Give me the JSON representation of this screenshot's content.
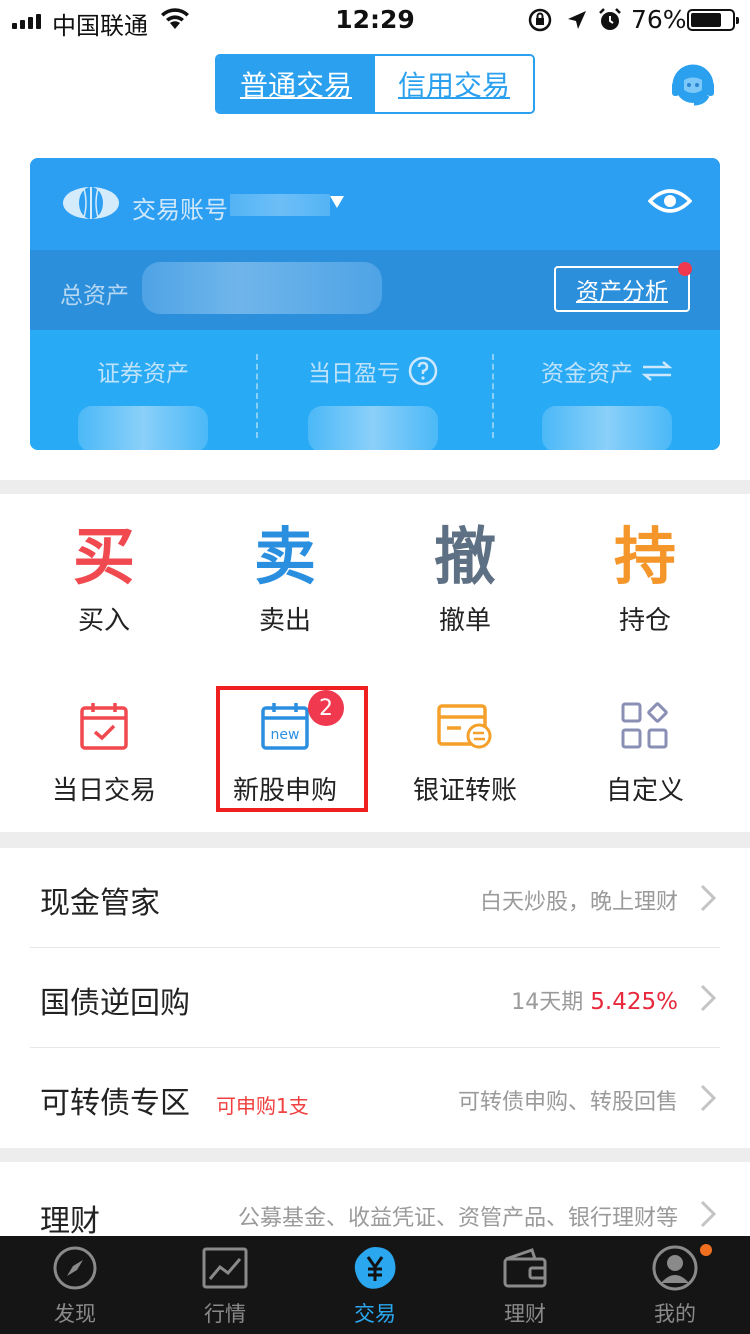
{
  "status_bar": {
    "carrier": "中国联通",
    "time": "12:29",
    "battery_percent": "76%",
    "battery_level": 0.76
  },
  "header": {
    "segment_active": "普通交易",
    "segment_inactive": "信用交易",
    "service_icon": "customer-service-icon"
  },
  "account_card": {
    "account_label": "交易账号",
    "total_assets_label": "总资产",
    "analysis_button": "资产分析",
    "stats": [
      {
        "label": "证券资产"
      },
      {
        "label": "当日盈亏"
      },
      {
        "label": "资金资产"
      }
    ]
  },
  "quick_actions": {
    "primary": [
      {
        "char": "买",
        "label": "买入",
        "color": "#f0494f"
      },
      {
        "char": "卖",
        "label": "卖出",
        "color": "#2b8fe0"
      },
      {
        "char": "撤",
        "label": "撤单",
        "color": "#5e7083"
      },
      {
        "char": "持",
        "label": "持仓",
        "color": "#f5962a"
      }
    ],
    "secondary": [
      {
        "label": "当日交易",
        "icon": "calendar-check-icon"
      },
      {
        "label": "新股申购",
        "icon": "calendar-new-icon",
        "badge": "2",
        "icon_text": "new"
      },
      {
        "label": "银证转账",
        "icon": "card-transfer-icon"
      },
      {
        "label": "自定义",
        "icon": "grid-icon"
      }
    ]
  },
  "menu_list": [
    {
      "title": "现金管家",
      "right_text": "白天炒股，晚上理财"
    },
    {
      "title": "国债逆回购",
      "right_text": "14天期",
      "rate": "5.425%"
    },
    {
      "title": "可转债专区",
      "tag": "可申购1支",
      "right_text": "可转债申购、转股回售"
    },
    {
      "title": "理财",
      "right_text": "公募基金、收益凭证、资管产品、银行理财等"
    }
  ],
  "tab_bar": {
    "tabs": [
      {
        "label": "发现",
        "icon": "compass-icon",
        "active": false
      },
      {
        "label": "行情",
        "icon": "chart-icon",
        "active": false
      },
      {
        "label": "交易",
        "icon": "yen-icon",
        "active": true
      },
      {
        "label": "理财",
        "icon": "wallet-icon",
        "active": false
      },
      {
        "label": "我的",
        "icon": "user-icon",
        "active": false
      }
    ]
  }
}
